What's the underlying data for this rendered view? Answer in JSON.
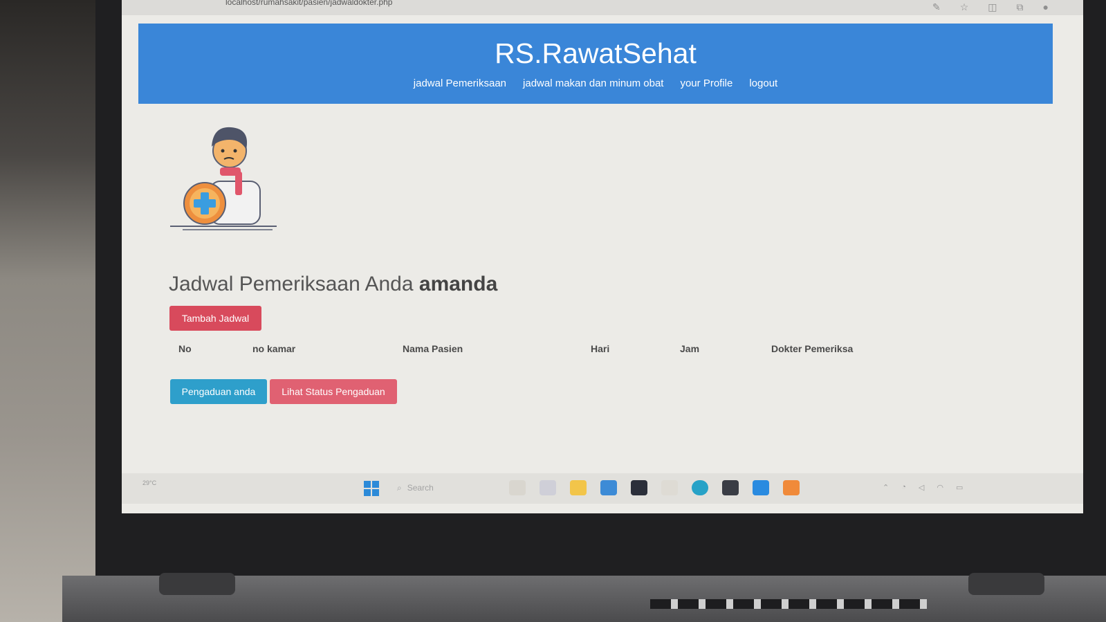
{
  "browser": {
    "url": "localhost/rumahsakit/pasien/jadwaldokter.php"
  },
  "site": {
    "title": "RS.RawatSehat",
    "nav": [
      "jadwal Pemeriksaan",
      "jadwal makan dan minum obat",
      "your Profile",
      "logout"
    ]
  },
  "page": {
    "heading_prefix": "Jadwal Pemeriksaan Anda",
    "username": "amanda",
    "add_button": "Tambah Jadwal",
    "table_headers": [
      "No",
      "no kamar",
      "Nama Pasien",
      "Hari",
      "Jam",
      "Dokter Pemeriksa"
    ],
    "complaint_button": "Pengaduan anda",
    "status_button": "Lihat Status Pengaduan"
  },
  "taskbar": {
    "search_placeholder": "Search",
    "weather": "29°C",
    "apps": [
      "explorer-icon",
      "chat-icon",
      "folder-icon",
      "store-icon",
      "dropbox-icon",
      "app-icon",
      "edge-icon",
      "terminal-icon",
      "vscode-icon",
      "sublime-icon"
    ]
  },
  "colors": {
    "header": "#3a86d8",
    "add_button": "#d84a5c",
    "complaint_button": "#2e9fcb",
    "status_button": "#e06172"
  }
}
